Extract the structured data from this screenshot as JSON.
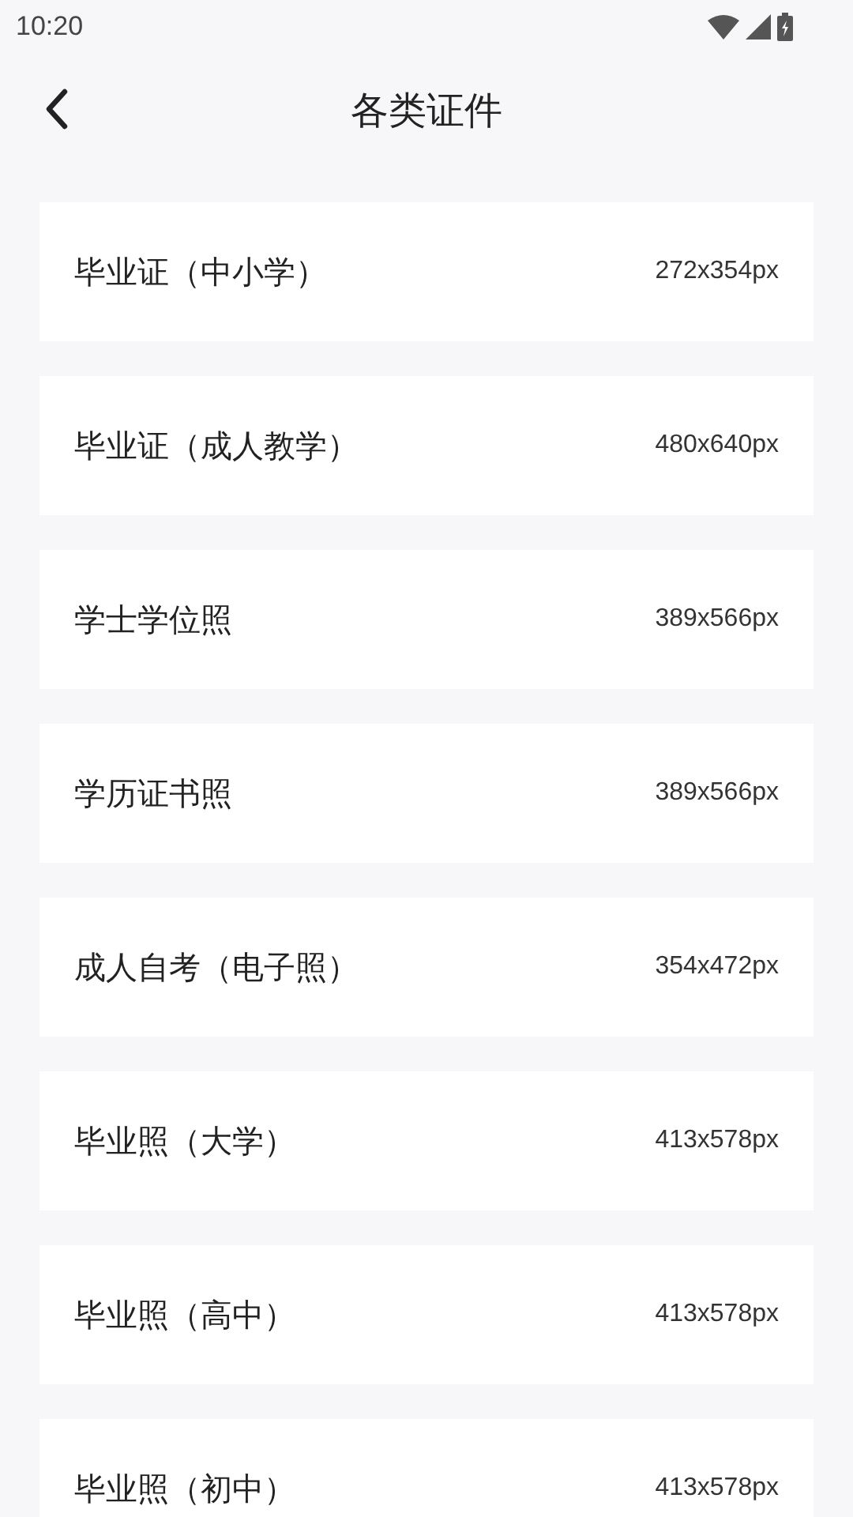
{
  "status_bar": {
    "time": "10:20"
  },
  "header": {
    "title": "各类证件"
  },
  "items": [
    {
      "name": "毕业证（中小学）",
      "size": "272x354px"
    },
    {
      "name": "毕业证（成人教学）",
      "size": "480x640px"
    },
    {
      "name": "学士学位照",
      "size": "389x566px"
    },
    {
      "name": "学历证书照",
      "size": "389x566px"
    },
    {
      "name": "成人自考（电子照）",
      "size": "354x472px"
    },
    {
      "name": "毕业照（大学）",
      "size": "413x578px"
    },
    {
      "name": "毕业照（高中）",
      "size": "413x578px"
    },
    {
      "name": "毕业照（初中）",
      "size": "413x578px"
    }
  ]
}
